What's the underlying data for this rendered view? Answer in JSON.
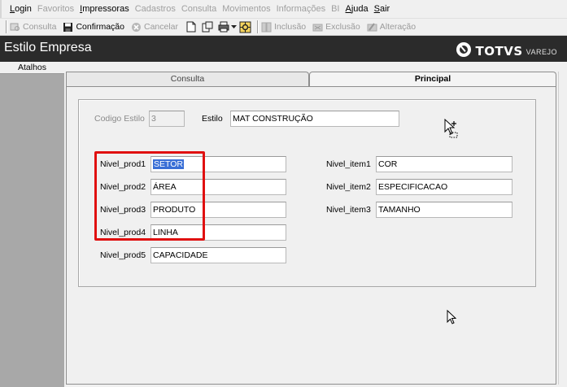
{
  "menu": [
    {
      "label": "Login",
      "enabled": true
    },
    {
      "label": "Favoritos",
      "enabled": false
    },
    {
      "label": "Impressoras",
      "enabled": true
    },
    {
      "label": "Cadastros",
      "enabled": false
    },
    {
      "label": "Consulta",
      "enabled": false
    },
    {
      "label": "Movimentos",
      "enabled": false
    },
    {
      "label": "Informações",
      "enabled": false
    },
    {
      "label": "BI",
      "enabled": false
    },
    {
      "label": "Ajuda",
      "enabled": true
    },
    {
      "label": "Sair",
      "enabled": true
    }
  ],
  "toolbar": {
    "consulta": "Consulta",
    "confirmacao": "Confirmação",
    "cancelar": "Cancelar",
    "inclusao": "Inclusão",
    "exclusao": "Exclusão",
    "alteracao": "Alteração"
  },
  "window": {
    "title": "Estilo Empresa",
    "brand": "TOTVS",
    "brand_sub": "VAREJO"
  },
  "sidebar": {
    "header": "Atalhos"
  },
  "tabs": {
    "consulta": "Consulta",
    "principal": "Principal"
  },
  "form": {
    "codigo_label": "Codigo Estilo",
    "codigo_value": "3",
    "estilo_label": "Estilo",
    "estilo_value": "MAT CONSTRUÇÃO",
    "prod": [
      {
        "label": "Nivel_prod1",
        "value": "SETOR"
      },
      {
        "label": "Nivel_prod2",
        "value": "ÁREA"
      },
      {
        "label": "Nivel_prod3",
        "value": "PRODUTO"
      },
      {
        "label": "Nivel_prod4",
        "value": "LINHA"
      },
      {
        "label": "Nivel_prod5",
        "value": "CAPACIDADE"
      }
    ],
    "item": [
      {
        "label": "Nivel_item1",
        "value": "COR"
      },
      {
        "label": "Nivel_item2",
        "value": "ESPECIFICACAO"
      },
      {
        "label": "Nivel_item3",
        "value": "TAMANHO"
      }
    ]
  },
  "colors": {
    "titlebar": "#2b2b2b",
    "sidebar": "#a8a8a8",
    "highlight_box": "#e01010",
    "selection": "#3a6fd6"
  }
}
